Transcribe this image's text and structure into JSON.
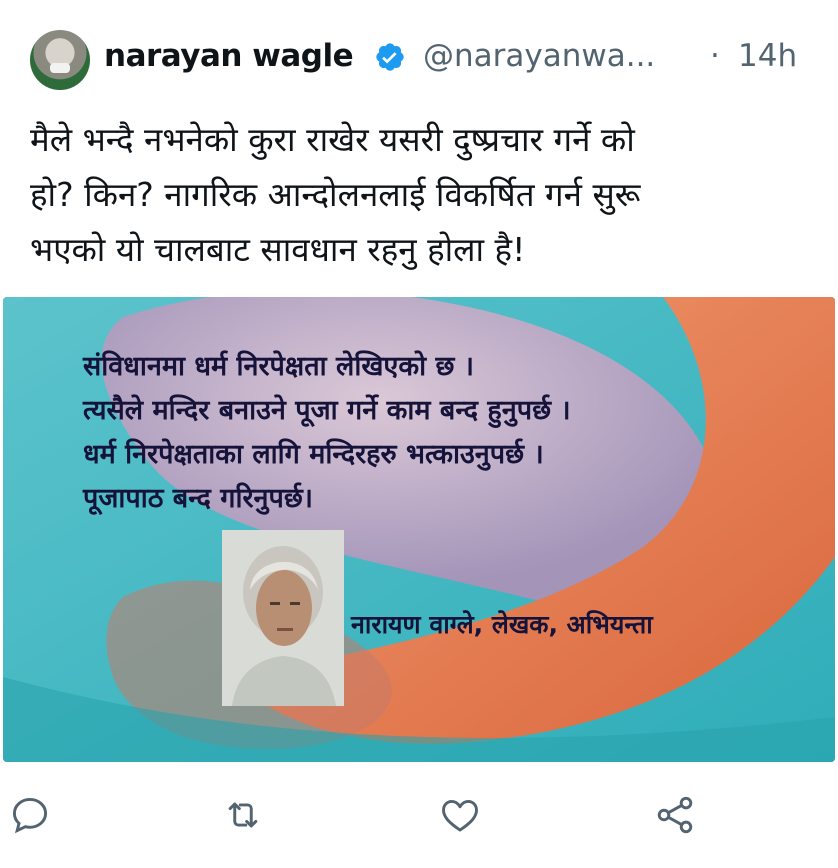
{
  "tweet": {
    "author_name": "narayan wagle",
    "handle": "@narayanwa...",
    "separator": "·",
    "time": "14h",
    "text_lines": [
      "मैले भन्दै नभनेको कुरा राखेर यसरी दुष्प्रचार गर्ने को",
      "हो? किन? नागरिक आन्दोलनलाई विकर्षित गर्न सुरू",
      "भएको यो चालबाट सावधान रहनु होला है!"
    ]
  },
  "media": {
    "quote_lines": [
      "संविधानमा धर्म निरपेक्षता लेखिएको छ ।",
      "त्यसैले मन्दिर बनाउने पूजा गर्ने काम बन्द हुनुपर्छ ।",
      "धर्म निरपेक्षताका लागि मन्दिरहरु भत्काउनुपर्छ ।",
      "पूजापाठ बन्द गरिनुपर्छ।"
    ],
    "caption": "नारायण वाग्ले, लेखक, अभियन्ता",
    "colors": {
      "teal": "#3ab7c3",
      "orange": "#e8784a",
      "lavender": "#c9a8c4"
    }
  },
  "actions": {
    "icons": [
      "reply-icon",
      "retweet-icon",
      "like-icon",
      "share-icon"
    ]
  }
}
